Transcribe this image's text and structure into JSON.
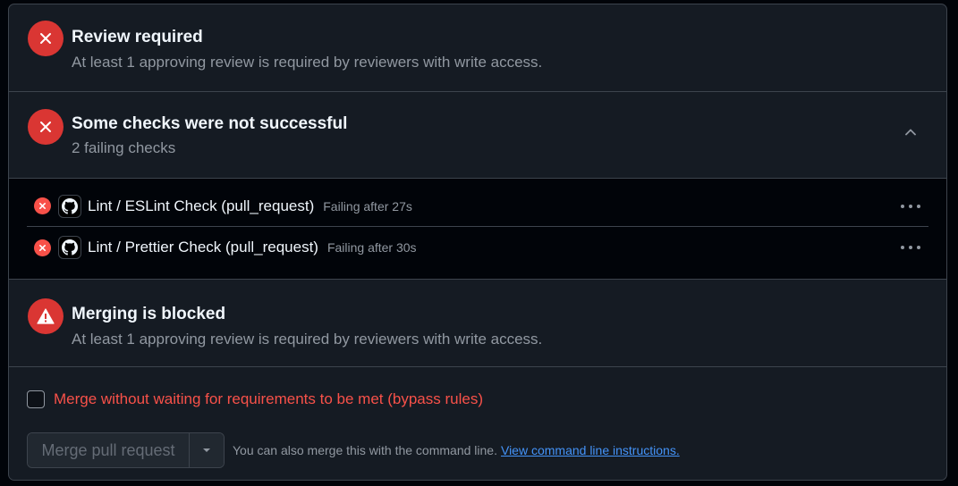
{
  "review": {
    "title": "Review required",
    "subtitle": "At least 1 approving review is required by reviewers with write access.",
    "icon": "x-circle-icon"
  },
  "checks": {
    "title": "Some checks were not successful",
    "subtitle": "2 failing checks",
    "icon": "x-circle-icon",
    "toggle_icon": "chevron-up-icon",
    "items": [
      {
        "name": "Lint / ESLint Check (pull_request)",
        "status": "Failing after 27s"
      },
      {
        "name": "Lint / Prettier Check (pull_request)",
        "status": "Failing after 30s"
      }
    ]
  },
  "blocked": {
    "title": "Merging is blocked",
    "subtitle": "At least 1 approving review is required by reviewers with write access.",
    "icon": "alert-icon"
  },
  "merge": {
    "bypass_label": "Merge without waiting for requirements to be met (bypass rules)",
    "bypass_checked": false,
    "button_label": "Merge pull request",
    "cli_text": "You can also merge this with the command line.",
    "cli_link": "View command line instructions."
  },
  "colors": {
    "danger": "#da3633",
    "danger_text": "#f85149",
    "link": "#4493f8",
    "panel_bg": "#151b23",
    "border": "#3d444d"
  }
}
